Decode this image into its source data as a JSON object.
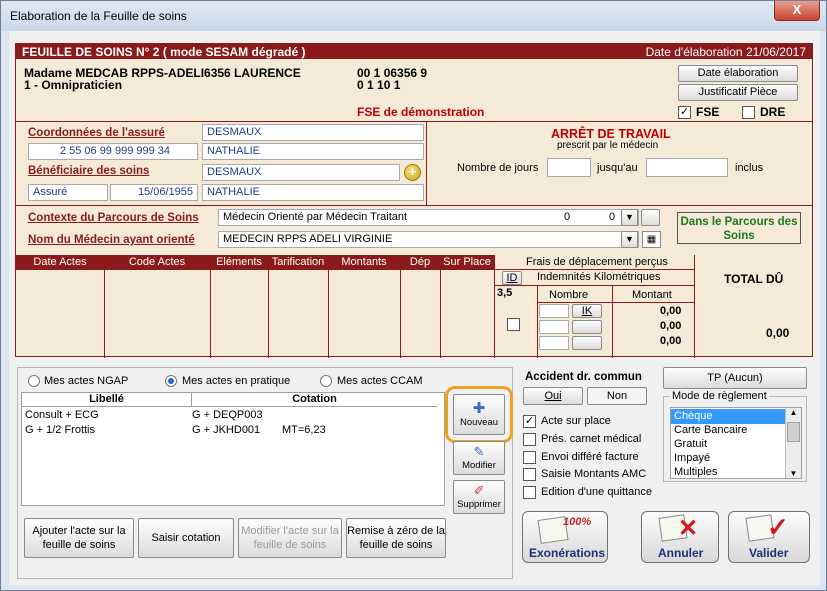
{
  "window": {
    "title": "Elaboration de la Feuille de soins",
    "close_label": "X"
  },
  "header": {
    "title": "FEUILLE DE SOINS  N° 2 ( mode SESAM dégradé )",
    "date_label": "Date d'élaboration 21/06/2017"
  },
  "patient": {
    "doctor_name": "Madame MEDCAB RPPS-ADELI6356 LAURENCE",
    "specialty": "1 - Omnipraticien",
    "id1": "00 1 06356 9",
    "id2": "0 1 10 1",
    "demo_label": "FSE de démonstration"
  },
  "buttons": {
    "date_elab": "Date élaboration",
    "justif": "Justificatif Pièce",
    "fse": "FSE",
    "dre": "DRE"
  },
  "assure": {
    "coord_label": "Coordonnées de l'assuré",
    "nom": "DESMAUX",
    "numero": "2 55 06 99 999 999 34",
    "prenom": "NATHALIE",
    "benef_label": "Bénéficiaire des soins",
    "benef_nom": "DESMAUX",
    "qualite": "Assuré",
    "naissance": "15/06/1955",
    "benef_prenom": "NATHALIE"
  },
  "arret": {
    "title": "ARRÊT DE TRAVAIL",
    "subtitle": "prescrit par le médecin",
    "jours_label": "Nombre de jours",
    "jusqu_label": "jusqu'au",
    "inclus_label": "inclus"
  },
  "parcours": {
    "contexte_label": "Contexte du Parcours de Soins",
    "contexte_value": "Médecin Orienté par Médecin Traitant",
    "contexte_v1": "0",
    "contexte_v2": "0",
    "medecin_label": "Nom du Médecin ayant orienté",
    "medecin_value": "MEDECIN RPPS ADELI   VIRGINIE",
    "status": "Dans le Parcours des Soins"
  },
  "actes_table": {
    "columns": [
      "Date Actes",
      "Code Actes",
      "Eléments",
      "Tarification",
      "Montants",
      "Dép",
      "Sur Place"
    ],
    "frais_title": "Frais de déplacement perçus",
    "id_label": "ID",
    "indemnites_label": "Indemnités Kilométriques",
    "id_value": "3,5",
    "nombre_label": "Nombre",
    "montant_label": "Montant",
    "ik_label": "IK",
    "montants": [
      "0,00",
      "0,00",
      "0,00"
    ],
    "total_label": "TOTAL DÛ",
    "total_value": "0,00"
  },
  "actes_panel": {
    "radio_ngap": "Mes actes NGAP",
    "radio_pratique": "Mes actes en pratique",
    "radio_ccam": "Mes actes CCAM",
    "col_libelle": "Libellé",
    "col_cotation": "Cotation",
    "rows": [
      {
        "libelle": "Consult + ECG",
        "cotation": "G + DEQP003",
        "extra": ""
      },
      {
        "libelle": "G + 1/2 Frottis",
        "cotation": "G + JKHD001",
        "extra": "MT=6,23"
      }
    ],
    "nouveau": "Nouveau",
    "modifier": "Modifier",
    "supprimer": "Supprimer"
  },
  "bottom_buttons": {
    "ajouter": "Ajouter l'acte sur la feuille de soins",
    "saisir": "Saisir cotation",
    "modifier_acte": "Modifier l'acte sur la feuille de soins",
    "remise": "Remise à zéro de la feuille de soins"
  },
  "accident": {
    "title": "Accident dr. commun",
    "oui": "Oui",
    "non": "Non",
    "checks": [
      {
        "label": "Acte sur place",
        "checked": true
      },
      {
        "label": "Prés. carnet médical",
        "checked": false
      },
      {
        "label": "Envoi différé facture",
        "checked": false
      },
      {
        "label": "Saisie Montants AMC",
        "checked": false
      },
      {
        "label": "Edition d'une quittance",
        "checked": false
      }
    ]
  },
  "reglement": {
    "tp_button": "TP (Aucun)",
    "group_label": "Mode de règlement",
    "options": [
      "Chèque",
      "Carte Bancaire",
      "Gratuit",
      "Impayé",
      "Multiples"
    ],
    "selected": "Chèque"
  },
  "actions": {
    "exonerations": "Exonérations",
    "annuler": "Annuler",
    "valider": "Valider",
    "badge": "100%"
  }
}
